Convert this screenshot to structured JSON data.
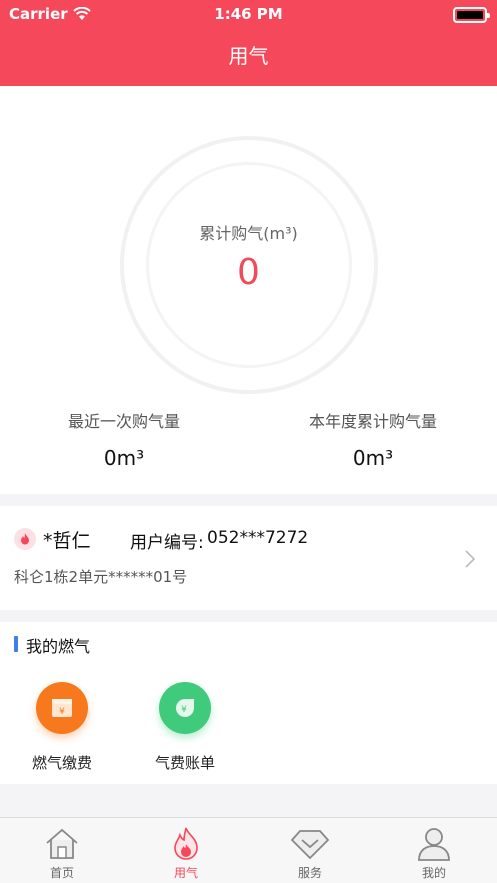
{
  "status_bar": {
    "carrier": "Carrier",
    "time": "1:46 PM"
  },
  "nav": {
    "title": "用气"
  },
  "summary": {
    "total_label": "累计购气(m³)",
    "total_value": "0",
    "recent_label": "最近一次购气量",
    "recent_value": "0m³",
    "year_label": "本年度累计购气量",
    "year_value": "0m³"
  },
  "user": {
    "name": "*哲仁",
    "id_label": "用户编号:",
    "id_value": "052***7272",
    "address": "科仑1栋2单元******01号"
  },
  "my_gas": {
    "title": "我的燃气",
    "items": [
      {
        "label": "燃气缴费",
        "icon": "gas-payment-icon",
        "color": "#f7781d"
      },
      {
        "label": "气费账单",
        "icon": "gas-bill-icon",
        "color": "#3fcb7b"
      }
    ]
  },
  "tabbar": {
    "tabs": [
      {
        "label": "首页",
        "icon": "home-icon"
      },
      {
        "label": "用气",
        "icon": "flame-icon"
      },
      {
        "label": "服务",
        "icon": "service-diamond-icon"
      },
      {
        "label": "我的",
        "icon": "profile-icon"
      }
    ],
    "active_index": 1
  },
  "colors": {
    "brand": "#f5485b",
    "accent_blue": "#3e7cf2"
  }
}
